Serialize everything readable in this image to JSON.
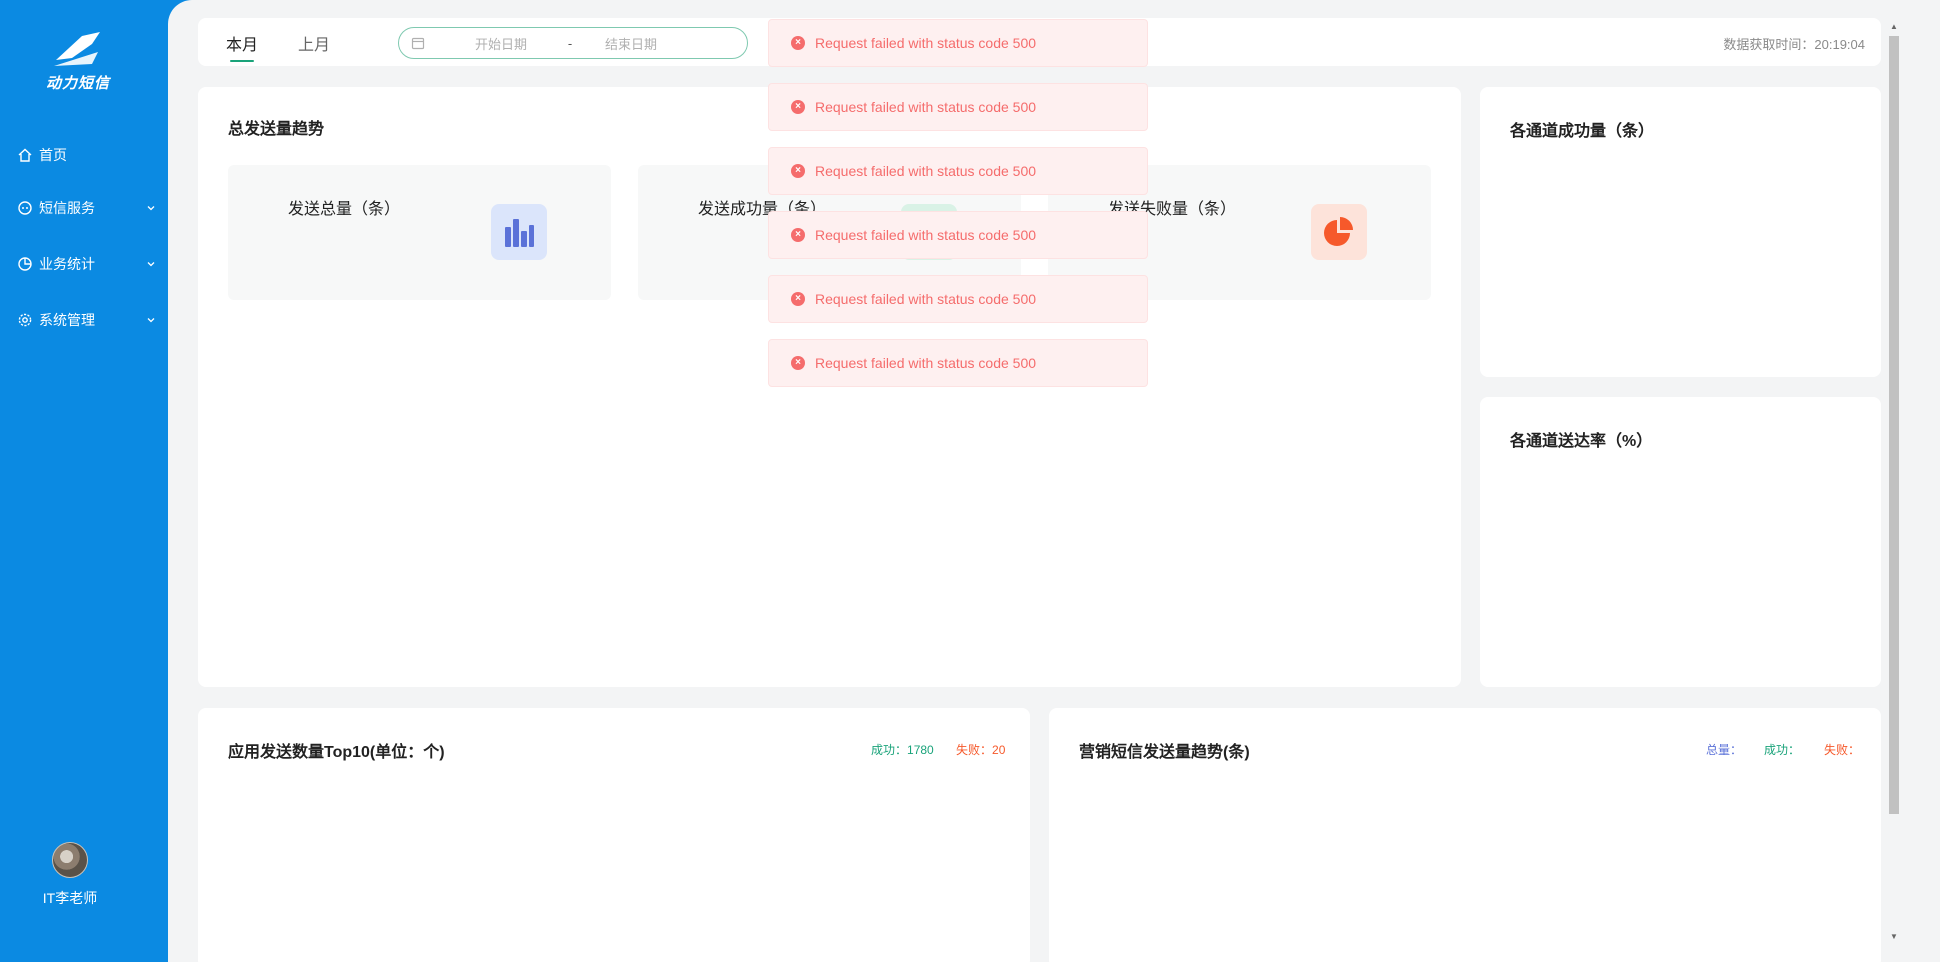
{
  "sidebar": {
    "logo_text": "动力短信",
    "items": [
      {
        "label": "首页",
        "icon": "home-icon"
      },
      {
        "label": "短信服务",
        "icon": "message-icon"
      },
      {
        "label": "业务统计",
        "icon": "pie-chart-icon"
      },
      {
        "label": "系统管理",
        "icon": "gear-icon"
      }
    ],
    "user_name": "IT李老师"
  },
  "topbar": {
    "tabs": [
      "本月",
      "上月"
    ],
    "active_tab": "本月",
    "start_placeholder": "开始日期",
    "separator": "-",
    "end_placeholder": "结束日期",
    "fetch_time": "数据获取时间：20:19:04"
  },
  "trend": {
    "title": "总发送量趋势",
    "stats": [
      {
        "label": "发送总量（条）",
        "icon": "bar-chart-icon",
        "color": "#5b72d8"
      },
      {
        "label": "发送成功量（条）",
        "icon": "check-icon",
        "color": "#2bb673"
      },
      {
        "label": "发送失败量（条）",
        "icon": "pie-chart-icon",
        "color": "#f6592b"
      }
    ]
  },
  "side": {
    "success_title": "各通道成功量（条）",
    "rate_title": "各通道送达率（%）"
  },
  "bottom": {
    "top10_title": "应用发送数量Top10(单位：个)",
    "top10_success_label": "成功：",
    "top10_success_value": "1780",
    "top10_fail_label": "失败：",
    "top10_fail_value": "20",
    "marketing_title": "营销短信发送量趋势(条)",
    "marketing_total_label": "总量：",
    "marketing_success_label": "成功：",
    "marketing_fail_label": "失败："
  },
  "colors": {
    "primary": "#0b8ae2",
    "success": "#1aa37a",
    "fail": "#f6592b",
    "total": "#5b72d8",
    "error": "#f56c6c"
  },
  "toasts": [
    "Request failed with status code 500",
    "Request failed with status code 500",
    "Request failed with status code 500",
    "Request failed with status code 500",
    "Request failed with status code 500",
    "Request failed with status code 500"
  ]
}
